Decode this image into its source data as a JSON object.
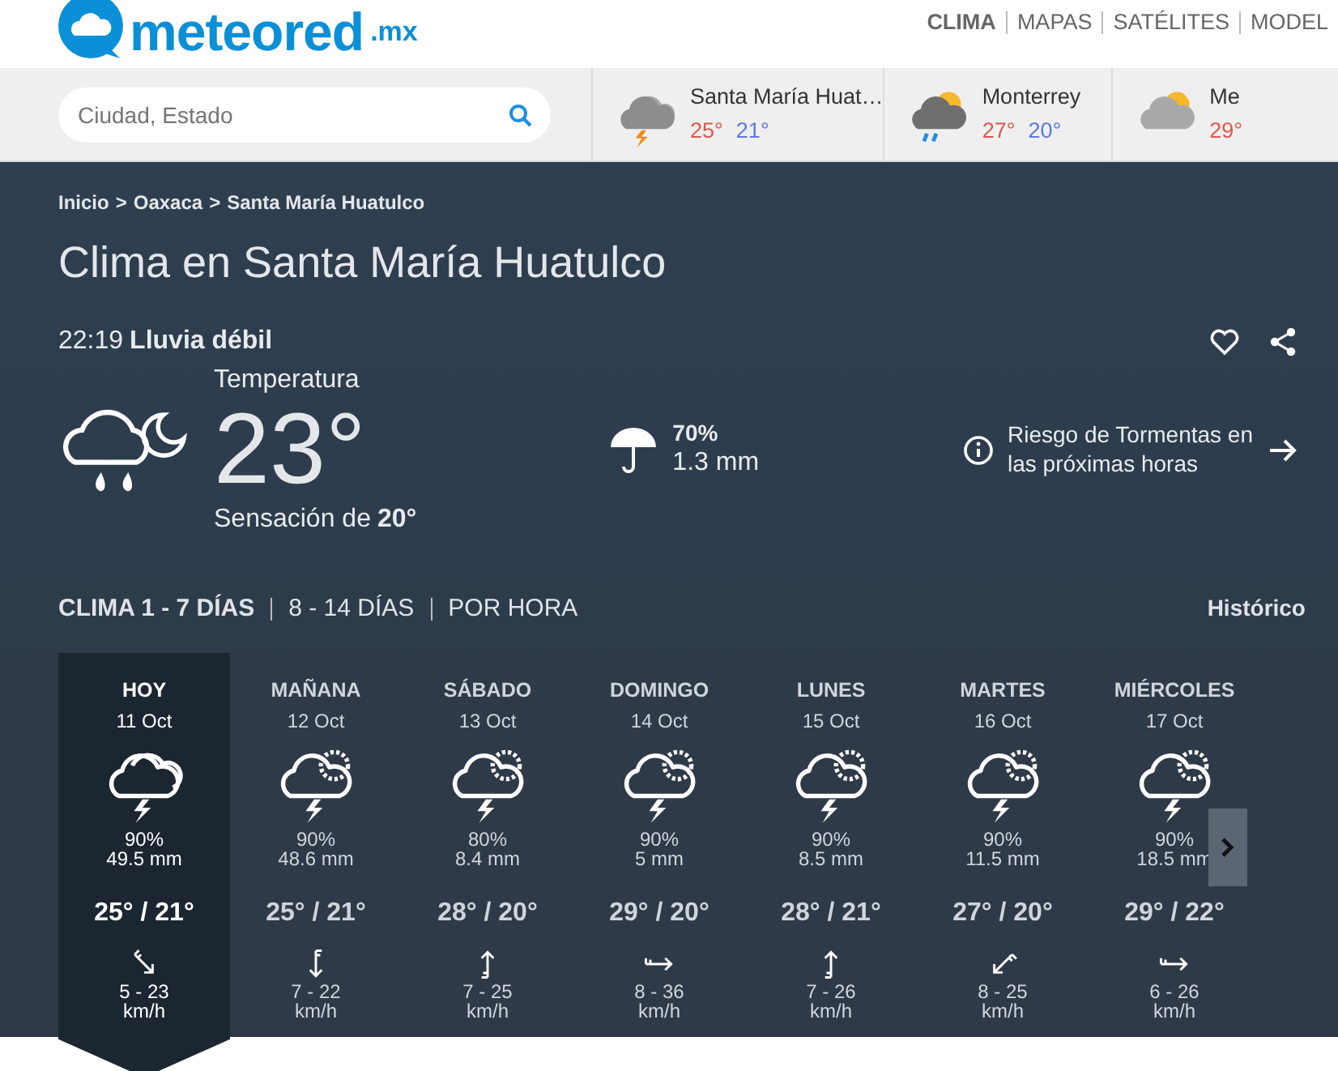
{
  "header": {
    "logo": {
      "name": "meteored",
      "suffix": ".mx"
    },
    "nav": [
      {
        "label": "CLIMA",
        "selected": true
      },
      {
        "label": "MAPAS",
        "selected": false
      },
      {
        "label": "SATÉLITES",
        "selected": false
      },
      {
        "label": "MODEL",
        "selected": false
      }
    ]
  },
  "search": {
    "placeholder": "Ciudad, Estado"
  },
  "cities": [
    {
      "name": "Santa María Huat…",
      "max": "25°",
      "min": "21°",
      "kind": "storm"
    },
    {
      "name": "Monterrey",
      "max": "27°",
      "min": "20°",
      "kind": "rain-partly"
    },
    {
      "name": "Me",
      "max": "29°",
      "kind": "partly"
    }
  ],
  "breadcrumb": [
    "Inicio",
    ">",
    "Oaxaca",
    ">",
    "Santa María Huatulco"
  ],
  "title": "Clima en Santa María Huatulco",
  "current": {
    "time": "22:19",
    "condition": "Lluvia débil",
    "temp_label": "Temperatura",
    "temp": "23°",
    "feels_label": "Sensación de",
    "feels": "20°",
    "rain_prob": "70%",
    "rain_amount": "1.3 mm",
    "alert": "Riesgo de Tormentas en las próximas horas"
  },
  "tabs": [
    {
      "label": "CLIMA 1 - 7 DÍAS",
      "selected": true
    },
    {
      "label": "8 - 14 DÍAS",
      "selected": false
    },
    {
      "label": "POR HORA",
      "selected": false
    }
  ],
  "history_link": "Histórico",
  "days": [
    {
      "day": "HOY",
      "date": "11 Oct",
      "kind": "storm-cloudy",
      "rain_prob": "90%",
      "rain": "49.5 mm",
      "temps": "25° / 21°",
      "wind": {
        "kind": "southeast",
        "range": "5 - 23",
        "unit": "km/h"
      },
      "selected": true
    },
    {
      "day": "MAÑANA",
      "date": "12 Oct",
      "kind": "storm-partly",
      "rain_prob": "90%",
      "rain": "48.6 mm",
      "temps": "25° / 21°",
      "wind": {
        "kind": "south",
        "range": "7 - 22",
        "unit": "km/h"
      },
      "selected": false
    },
    {
      "day": "SÁBADO",
      "date": "13 Oct",
      "kind": "storm-partly",
      "rain_prob": "80%",
      "rain": "8.4 mm",
      "temps": "28° / 20°",
      "wind": {
        "kind": "north",
        "range": "7 - 25",
        "unit": "km/h"
      },
      "selected": false
    },
    {
      "day": "DOMINGO",
      "date": "14 Oct",
      "kind": "storm-partly",
      "rain_prob": "90%",
      "rain": "5 mm",
      "temps": "29° / 20°",
      "wind": {
        "kind": "east",
        "range": "8 - 36",
        "unit": "km/h"
      },
      "selected": false
    },
    {
      "day": "LUNES",
      "date": "15 Oct",
      "kind": "storm-partly",
      "rain_prob": "90%",
      "rain": "8.5 mm",
      "temps": "28° / 21°",
      "wind": {
        "kind": "north",
        "range": "7 - 26",
        "unit": "km/h"
      },
      "selected": false
    },
    {
      "day": "MARTES",
      "date": "16 Oct",
      "kind": "storm-partly",
      "rain_prob": "90%",
      "rain": "11.5 mm",
      "temps": "27° / 20°",
      "wind": {
        "kind": "southwest",
        "range": "8 - 25",
        "unit": "km/h"
      },
      "selected": false
    },
    {
      "day": "MIÉRCOLES",
      "date": "17 Oct",
      "kind": "storm-partly",
      "rain_prob": "90%",
      "rain": "18.5 mm",
      "temps": "29° / 22°",
      "wind": {
        "kind": "east",
        "range": "6 - 26",
        "unit": "km/h"
      },
      "selected": false
    }
  ]
}
